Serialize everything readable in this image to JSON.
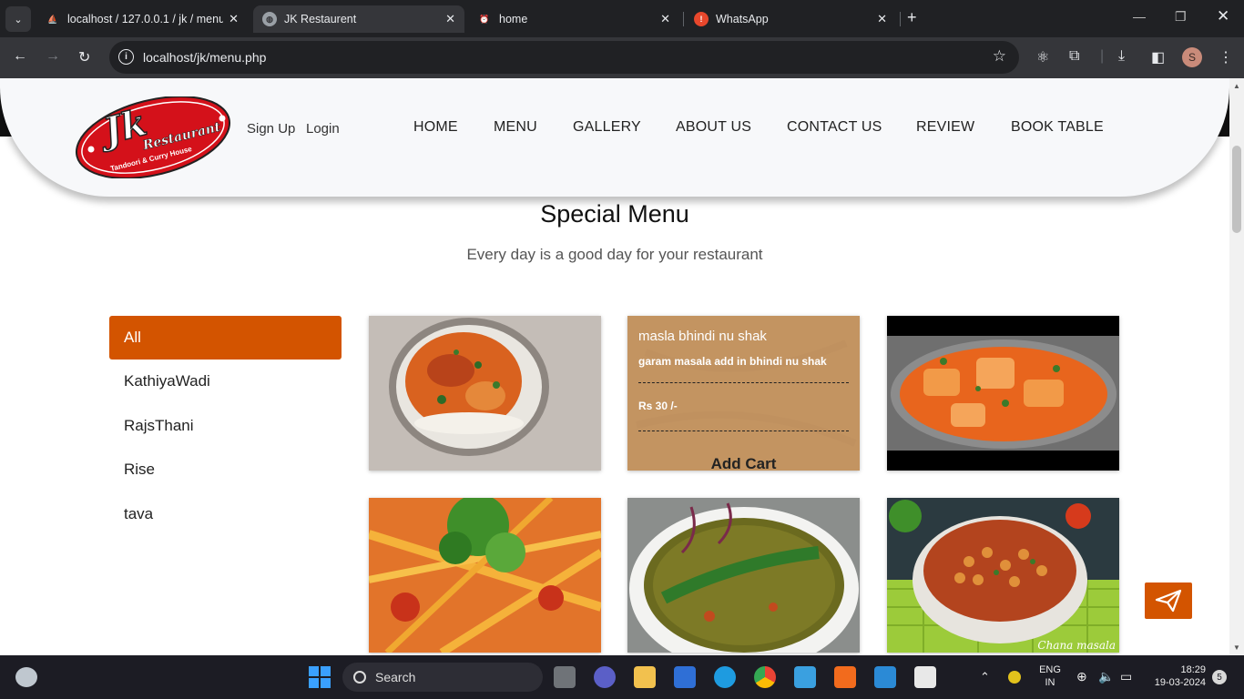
{
  "browser": {
    "tabs": [
      {
        "title": "localhost / 127.0.0.1 / jk / menu",
        "favicon": "phpmyadmin-icon"
      },
      {
        "title": "JK Restaurent",
        "favicon": "globe-icon"
      },
      {
        "title": "home",
        "favicon": "alarm-icon"
      },
      {
        "title": "WhatsApp",
        "favicon": "whatsapp-icon"
      }
    ],
    "url": "localhost/jk/menu.php",
    "profile_initial": "S"
  },
  "site": {
    "logo": {
      "main": "Jk",
      "sub": "Restaurant",
      "tagline": "Tandoori & Curry House"
    },
    "auth": {
      "signup": "Sign Up",
      "login": "Login"
    },
    "nav": [
      "HOME",
      "MENU",
      "GALLERY",
      "ABOUT US",
      "CONTACT US",
      "REVIEW",
      "BOOK TABLE"
    ],
    "section_title": "Special Menu",
    "section_subtitle": "Every day is a good day for your restaurant",
    "categories": [
      "All",
      "KathiyaWadi",
      "RajsThani",
      "Rise",
      "tava"
    ],
    "active_category": "All",
    "hover_card": {
      "name": "masla bhindi nu shak",
      "description": "garam masala add in bhindi nu shak",
      "price": "Rs 30 /-",
      "cta": "Add Cart"
    },
    "watermark": "Chana masala",
    "colors": {
      "accent": "#d35400",
      "overlay": "#c49664"
    }
  },
  "taskbar": {
    "search_placeholder": "Search",
    "lang_top": "ENG",
    "lang_bottom": "IN",
    "time": "18:29",
    "date": "19-03-2024",
    "notification_count": "5"
  }
}
